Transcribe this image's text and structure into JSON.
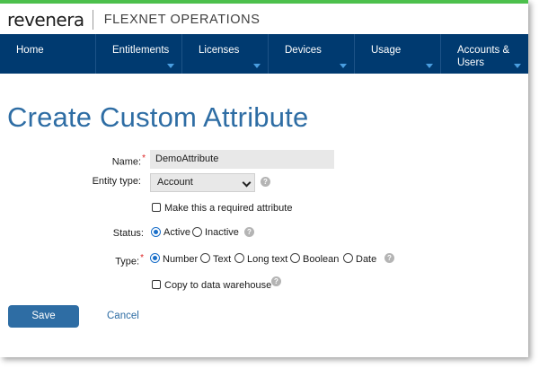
{
  "header": {
    "logo": "revenera",
    "product": "FLEXNET OPERATIONS"
  },
  "nav": {
    "items": [
      {
        "label": "Home",
        "has_menu": false
      },
      {
        "label": "Entitlements",
        "has_menu": true
      },
      {
        "label": "Licenses",
        "has_menu": true
      },
      {
        "label": "Devices",
        "has_menu": true
      },
      {
        "label": "Usage",
        "has_menu": true
      },
      {
        "label": "Accounts & Users",
        "has_menu": true
      }
    ]
  },
  "page": {
    "title": "Create Custom Attribute"
  },
  "form": {
    "name_label": "Name:",
    "name_value": "DemoAttribute",
    "entity_type_label": "Entity type:",
    "entity_type_value": "Account",
    "required_checkbox_label": "Make this a required attribute",
    "status_label": "Status:",
    "status_options": [
      {
        "label": "Active",
        "selected": true
      },
      {
        "label": "Inactive",
        "selected": false
      }
    ],
    "type_label": "Type:",
    "type_options": [
      {
        "label": "Number",
        "selected": true
      },
      {
        "label": "Text",
        "selected": false
      },
      {
        "label": "Long text",
        "selected": false
      },
      {
        "label": "Boolean",
        "selected": false
      },
      {
        "label": "Date",
        "selected": false
      }
    ],
    "warehouse_checkbox_label": "Copy to data warehouse",
    "help_icon_glyph": "?",
    "required_marker": "*"
  },
  "actions": {
    "save_label": "Save",
    "cancel_label": "Cancel"
  },
  "colors": {
    "top_accent": "#4cc04c",
    "nav_background": "#003a70",
    "title_blue": "#2e6da4",
    "required_red": "#dd2222"
  }
}
